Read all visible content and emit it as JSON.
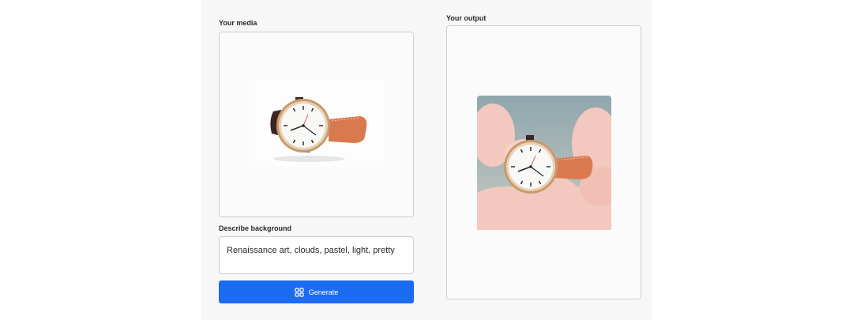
{
  "input_section": {
    "label": "Your media",
    "image_alt": "wristwatch-photo"
  },
  "prompt_section": {
    "label": "Describe background",
    "value": "Renaissance art, clouds, pastel, light, pretty"
  },
  "generate_button": {
    "label": "Generate",
    "icon": "sparkle-grid-icon"
  },
  "output_section": {
    "label": "Your output",
    "image_alt": "wristwatch-on-clouds"
  },
  "colors": {
    "accent": "#1b6cf2",
    "panel_bg": "#f7f7f7",
    "watch_strap": "#d97a4e",
    "sky": "#8fa7ad",
    "cloud": "#f3c8bf"
  }
}
